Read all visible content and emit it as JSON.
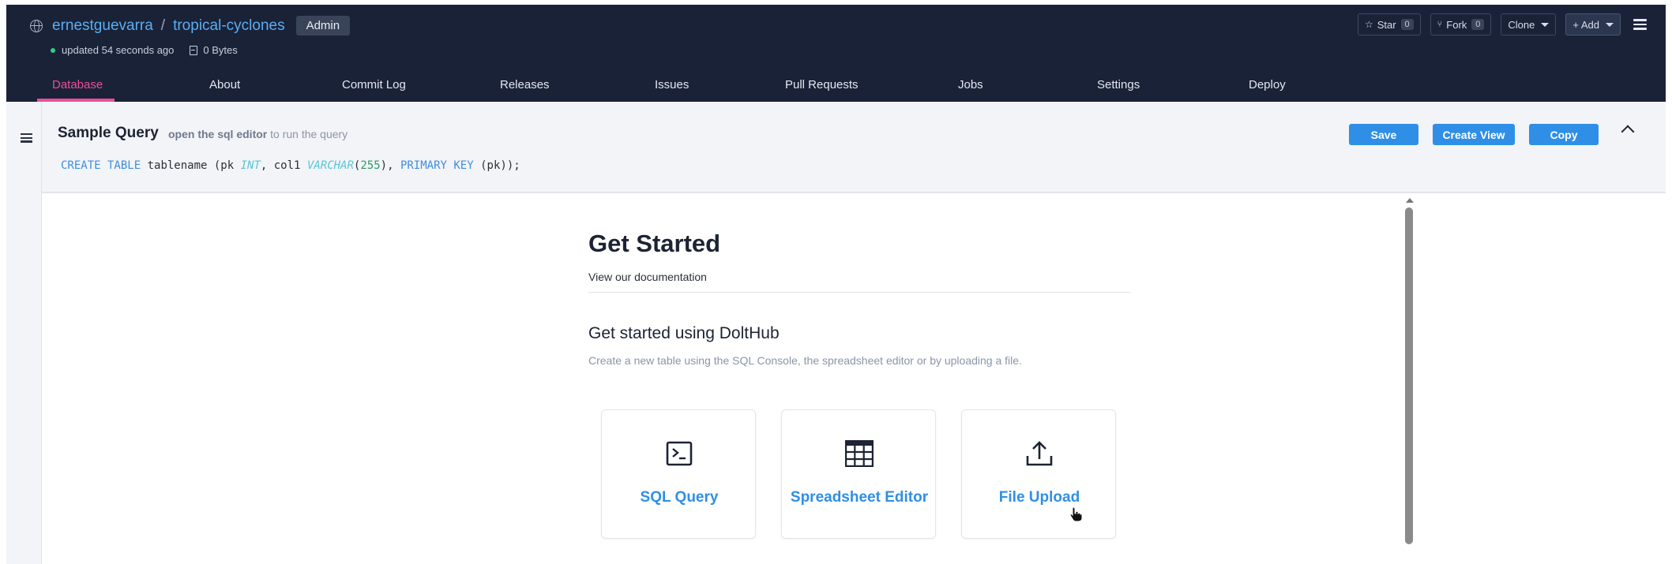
{
  "header": {
    "owner": "ernestguevarra",
    "separator": "/",
    "repo": "tropical-cyclones",
    "role_badge": "Admin",
    "updated": "updated 54 seconds ago",
    "size": "0 Bytes",
    "star_label": "Star",
    "star_count": "0",
    "fork_label": "Fork",
    "fork_count": "0",
    "clone_label": "Clone",
    "add_label": "+ Add"
  },
  "nav": {
    "items": [
      "Database",
      "About",
      "Commit Log",
      "Releases",
      "Issues",
      "Pull Requests",
      "Jobs",
      "Settings",
      "Deploy"
    ]
  },
  "query": {
    "title": "Sample Query",
    "hint_link": "open the sql editor",
    "hint_rest": " to run the query",
    "code": {
      "t1": "CREATE TABLE",
      "t2": " tablename (pk ",
      "t3": "INT",
      "t4": ", col1 ",
      "t5": "VARCHAR",
      "t6": "(",
      "t7": "255",
      "t8": "), ",
      "t9": "PRIMARY KEY",
      "t10": " (pk));"
    },
    "save_label": "Save",
    "create_view_label": "Create View",
    "copy_label": "Copy"
  },
  "main": {
    "title": "Get Started",
    "doc_link": "View our documentation",
    "subtitle": "Get started using DoltHub",
    "description": "Create a new table using the SQL Console, the spreadsheet editor or by uploading a file.",
    "cards": [
      {
        "label": "SQL Query",
        "icon": "terminal-icon"
      },
      {
        "label": "Spreadsheet Editor",
        "icon": "table-grid-icon"
      },
      {
        "label": "File Upload",
        "icon": "upload-icon"
      }
    ]
  },
  "colors": {
    "header_bg": "#1a2238",
    "accent_pink": "#ec4d9d",
    "link_blue": "#2f8fe6",
    "button_blue": "#2f8fe6"
  }
}
